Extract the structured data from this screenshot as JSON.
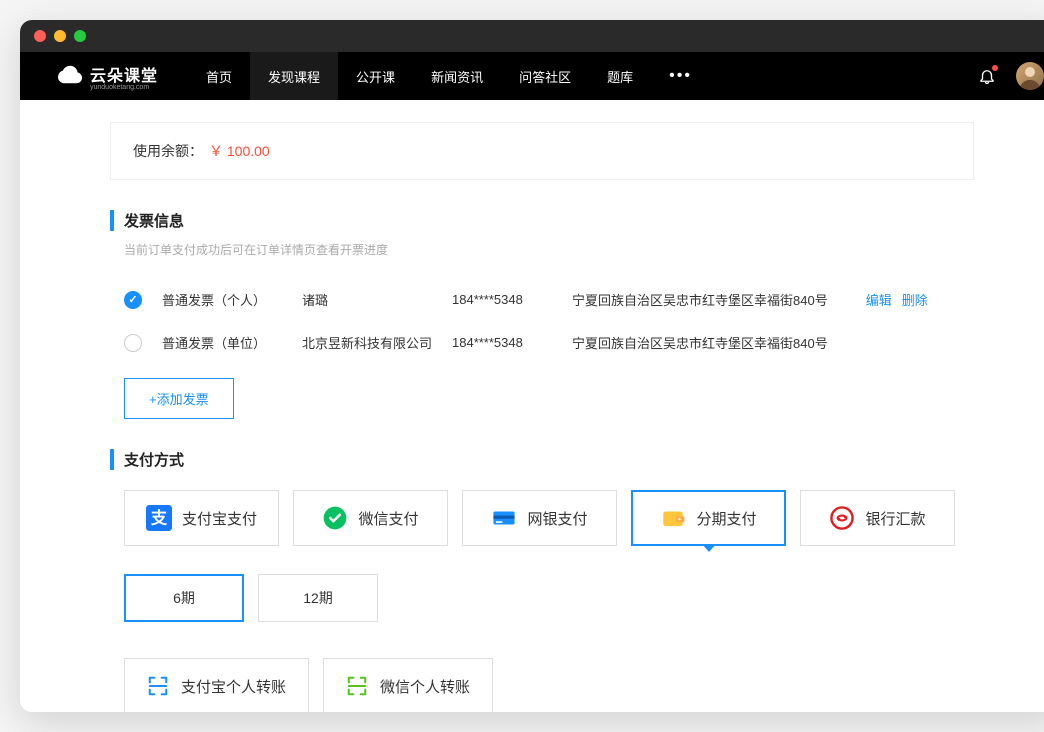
{
  "nav": {
    "brand": "云朵课堂",
    "brand_sub": "yunduoketang.com",
    "items": [
      "首页",
      "发现课程",
      "公开课",
      "新闻资讯",
      "问答社区",
      "题库"
    ],
    "active_index": 1
  },
  "balance": {
    "label": "使用余额：",
    "amount": "￥ 100.00"
  },
  "invoice": {
    "title": "发票信息",
    "hint": "当前订单支付成功后可在订单详情页查看开票进度",
    "rows": [
      {
        "type": "普通发票（个人）",
        "name": "诸璐",
        "phone": "184****5348",
        "address": "宁夏回族自治区吴忠市红寺堡区幸福街840号",
        "selected": true
      },
      {
        "type": "普通发票（单位）",
        "name": "北京昱新科技有限公司",
        "phone": "184****5348",
        "address": "宁夏回族自治区吴忠市红寺堡区幸福街840号",
        "selected": false
      }
    ],
    "edit_label": "编辑",
    "delete_label": "删除",
    "add_label": "+添加发票"
  },
  "payment": {
    "title": "支付方式",
    "methods": [
      {
        "id": "alipay",
        "label": "支付宝支付"
      },
      {
        "id": "wechat",
        "label": "微信支付"
      },
      {
        "id": "bankcard",
        "label": "网银支付"
      },
      {
        "id": "installment",
        "label": "分期支付"
      },
      {
        "id": "banktransfer",
        "label": "银行汇款"
      }
    ],
    "selected_method": "installment",
    "periods": [
      {
        "id": "6",
        "label": "6期"
      },
      {
        "id": "12",
        "label": "12期"
      }
    ],
    "selected_period": "6",
    "transfers": [
      {
        "id": "alipay-personal",
        "label": "支付宝个人转账",
        "color": "#1890ff"
      },
      {
        "id": "wechat-personal",
        "label": "微信个人转账",
        "color": "#52c41a"
      }
    ]
  }
}
